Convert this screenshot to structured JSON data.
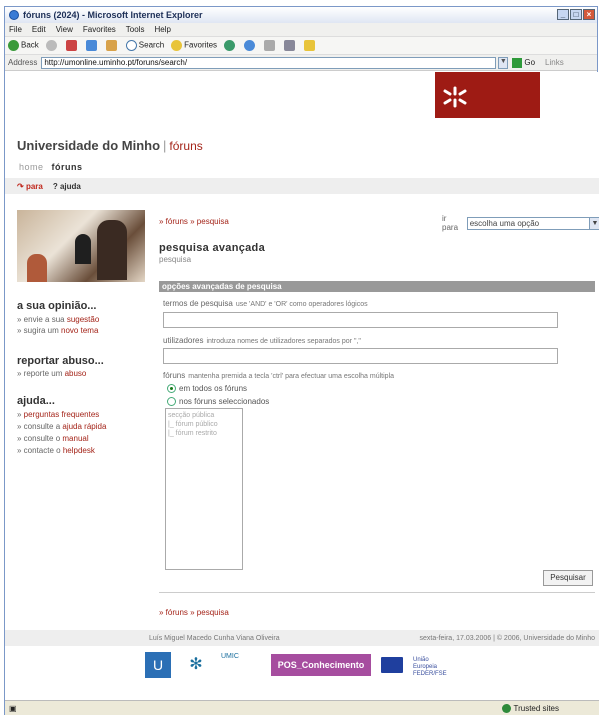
{
  "window": {
    "title": "fóruns (2024) - Microsoft Internet Explorer"
  },
  "menu": [
    "File",
    "Edit",
    "View",
    "Favorites",
    "Tools",
    "Help"
  ],
  "toolbar": {
    "back": "Back",
    "search": "Search",
    "favorites": "Favorites"
  },
  "address": {
    "label": "Address",
    "url": "http://umonline.uminho.pt/foruns/search/",
    "go": "Go",
    "links": "Links"
  },
  "header": {
    "university": "Universidade do Minho",
    "separator": "|",
    "section": "fóruns"
  },
  "nav": {
    "home": "home",
    "current": "fóruns"
  },
  "toolrow": {
    "para": "para",
    "ajuda": "ajuda"
  },
  "sidebar": {
    "opinion_title": "a sua opinião...",
    "opinion_items": [
      {
        "prefix": "» envie a sua ",
        "link": "sugestão"
      },
      {
        "prefix": "» sugira um ",
        "link": "novo tema"
      }
    ],
    "abuse_title": "reportar abuso...",
    "abuse_items": [
      {
        "prefix": "» reporte um ",
        "link": "abuso"
      }
    ],
    "help_title": "ajuda...",
    "help_items": [
      {
        "prefix": "» ",
        "link": "perguntas frequentes"
      },
      {
        "prefix": "» consulte a ",
        "link": "ajuda rápida"
      },
      {
        "prefix": "» consulte o ",
        "link": "manual"
      },
      {
        "prefix": "» contacte o ",
        "link": "helpdesk"
      }
    ]
  },
  "breadcrumb": "» fóruns » pesquisa",
  "goto": {
    "label": "ir para",
    "selected": "escolha uma opção"
  },
  "heading": {
    "title": "pesquisa avançada",
    "subtitle": "pesquisa"
  },
  "options_bar": "opções avançadas de pesquisa",
  "fields": {
    "terms_label": "termos de pesquisa",
    "terms_hint": "use 'AND' e 'OR' como operadores lógicos",
    "terms_value": "",
    "users_label": "utilizadores",
    "users_hint": "introduza nomes de utilizadores separados por \",\"",
    "users_value": "",
    "forums_label": "fóruns",
    "forums_hint": "mantenha premida a tecla 'ctrl' para efectuar uma escolha múltipla",
    "radio_all": "em todos os fóruns",
    "radio_selected": "nos fóruns seleccionados",
    "list_items": [
      "secção pública",
      "|_ fórum público",
      "|_ fórum restrito"
    ]
  },
  "submit": "Pesquisar",
  "bottom_breadcrumb": "» fóruns » pesquisa",
  "footer": {
    "user": "Luís Miguel Macedo Cunha Viana Oliveira",
    "date": "sexta-feira, 17.03.2006 | © 2006, Universidade do Minho"
  },
  "logos": {
    "umic": "UMIC",
    "pos": "POS_Conhecimento",
    "eu": "União Europeia FEDER/FSE"
  },
  "status": {
    "zone": "Trusted sites"
  }
}
